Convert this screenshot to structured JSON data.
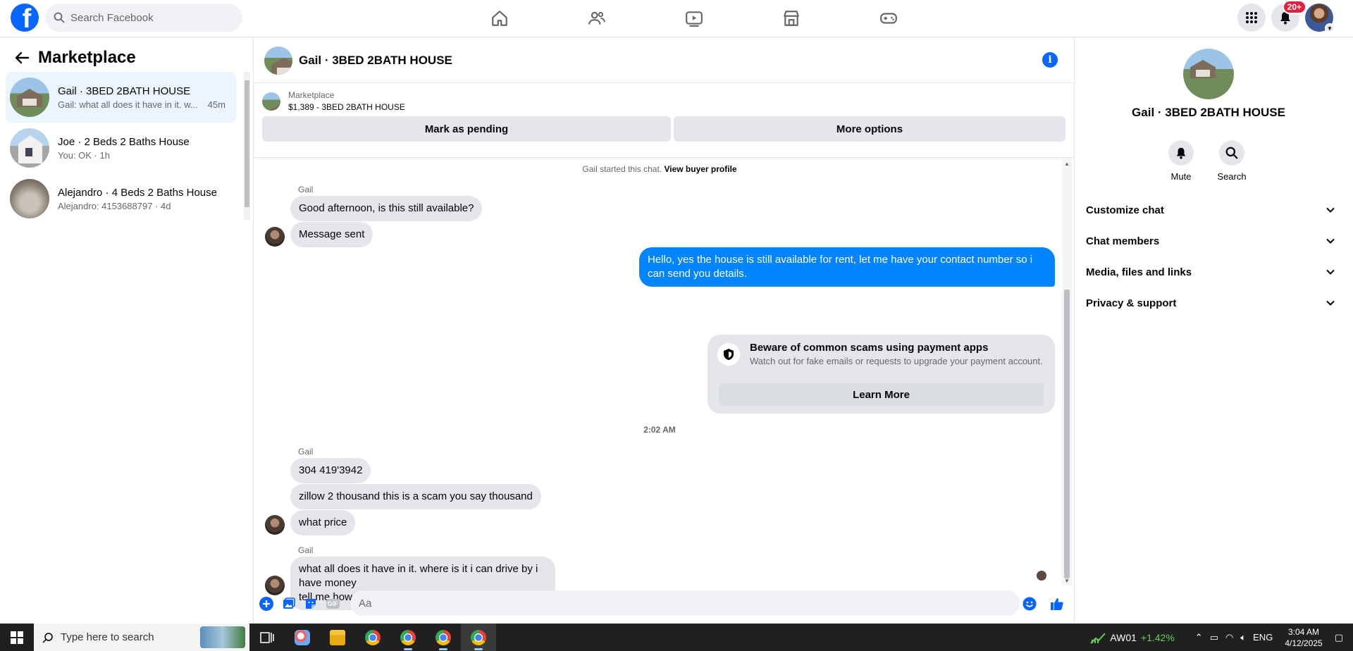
{
  "topnav": {
    "search_placeholder": "Search Facebook",
    "notification_badge": "20+"
  },
  "left": {
    "title": "Marketplace",
    "conversations": [
      {
        "name": "Gail · 3BED 2BATH HOUSE",
        "preview": "Gail: what all does it have in it. w...",
        "time": "45m",
        "active": true
      },
      {
        "name": "Joe · 2 Beds 2 Baths House",
        "preview": "You: OK · 1h",
        "time": "",
        "active": false
      },
      {
        "name": "Alejandro · 4 Beds 2 Baths House",
        "preview": "Alejandro: 4153688797 · 4d",
        "time": "",
        "active": false
      }
    ]
  },
  "chat": {
    "title": "Gail · 3BED 2BATH HOUSE",
    "marketplace_label": "Marketplace",
    "listing": "$1,389 - 3BED 2BATH HOUSE",
    "mark_pending": "Mark as pending",
    "more_options": "More options",
    "started_text": "Gail started this chat.",
    "view_buyer": "View buyer profile",
    "sender_name": "Gail",
    "messages_group1": [
      "Good afternoon, is this still available?",
      "Message sent"
    ],
    "outgoing": "Hello, yes the house is still available for rent, let me have your contact number so i can send you details.",
    "scam_title": "Beware of common scams using payment apps",
    "scam_text": "Watch out for fake emails or requests to upgrade your payment account.",
    "learn_more": "Learn More",
    "timestamp": "2:02 AM",
    "messages_group2": [
      "304 419'3942",
      "zillow 2 thousand this is a scam you say  thousand",
      "what price"
    ],
    "messages_group3": [
      "what all does it have in it. where is it i can drive by i have money",
      "tell me how to get to it"
    ],
    "composer_placeholder": "Aa"
  },
  "right": {
    "name": "Gail · 3BED 2BATH HOUSE",
    "mute": "Mute",
    "search": "Search",
    "items": [
      "Customize chat",
      "Chat members",
      "Media, files and links",
      "Privacy & support"
    ]
  },
  "taskbar": {
    "search_placeholder": "Type here to search",
    "stock_name": "AW01",
    "stock_change": "+1.42%",
    "language": "ENG",
    "time": "3:04 AM",
    "date": "4/12/2025"
  },
  "colors": {
    "brand": "#0866ff",
    "outgoing_bubble": "#0084ff",
    "active_conversation": "#ebf5ff"
  }
}
